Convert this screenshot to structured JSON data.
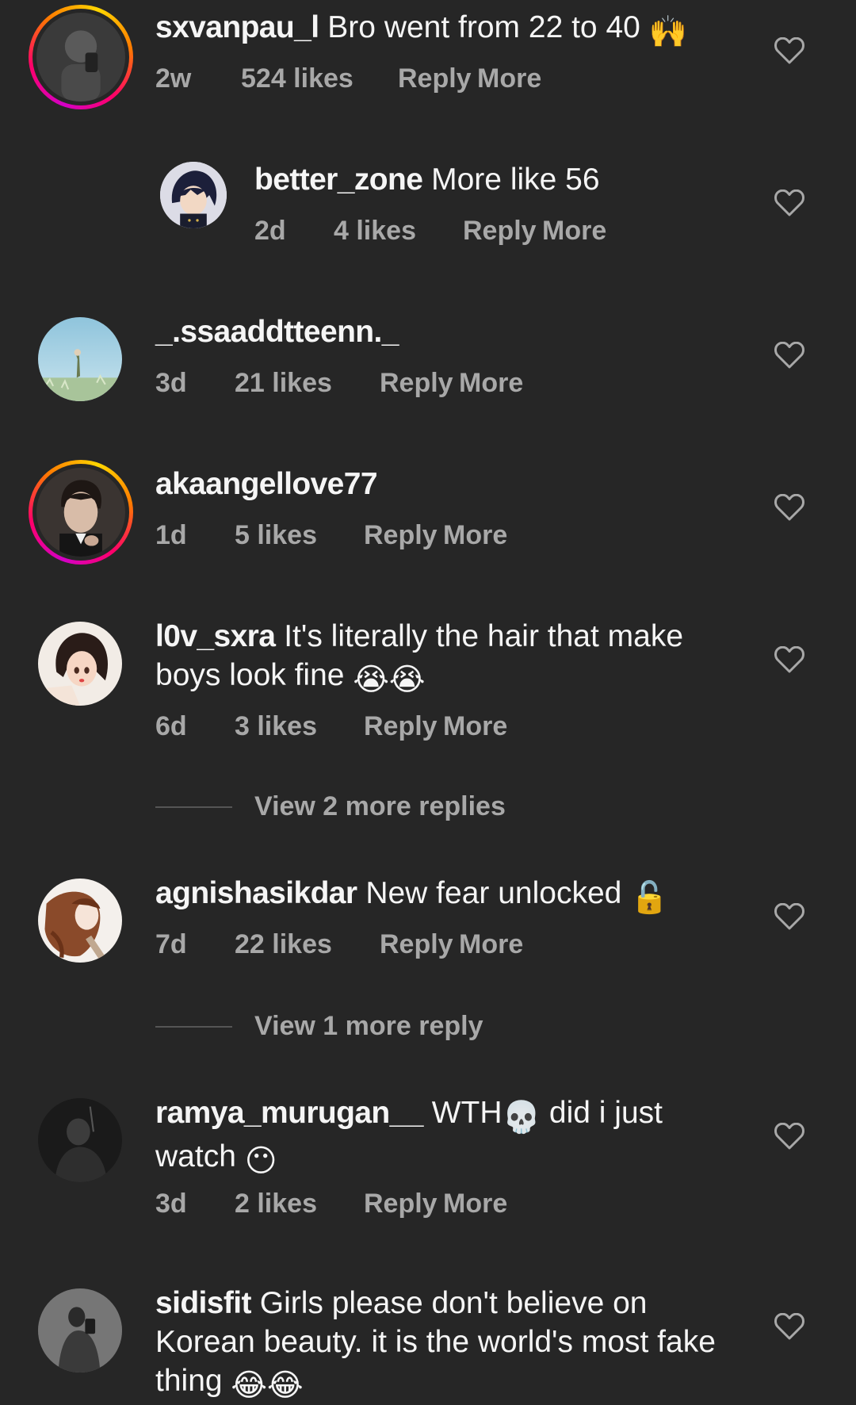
{
  "comments": [
    {
      "username": "sxvanpau_l",
      "text": "Bro went from 22 to 40",
      "emoji": "🙌",
      "time": "2w",
      "likes": "524 likes",
      "reply": "Reply",
      "more": "More"
    },
    {
      "username": "better_zone",
      "text": "More like 56",
      "time": "2d",
      "likes": "4 likes",
      "reply": "Reply",
      "more": "More"
    },
    {
      "username": "_.ssaaddtteenn._",
      "text": "",
      "time": "3d",
      "likes": "21 likes",
      "reply": "Reply",
      "more": "More"
    },
    {
      "username": "akaangellove77",
      "text": "",
      "time": "1d",
      "likes": "5 likes",
      "reply": "Reply",
      "more": "More"
    },
    {
      "username": "l0v_sxra",
      "text": "It's literally the hair that make boys look fine",
      "emoji": "😭😭",
      "time": "6d",
      "likes": "3 likes",
      "reply": "Reply",
      "more": "More",
      "view_replies": "View 2 more replies"
    },
    {
      "username": "agnishasikdar",
      "text": "New fear unlocked",
      "emoji": "🔓",
      "time": "7d",
      "likes": "22 likes",
      "reply": "Reply",
      "more": "More",
      "view_replies": "View 1 more reply"
    },
    {
      "username": "ramya_murugan__",
      "text_a": "WTH",
      "emoji_a": "💀",
      "text_b": "did i just watch",
      "emoji_b": "😶",
      "time": "3d",
      "likes": "2 likes",
      "reply": "Reply",
      "more": "More"
    },
    {
      "username": "sidisfit",
      "text": "Girls please don't believe on Korean beauty. it is the world's most fake thing",
      "emoji": "😂😂"
    }
  ],
  "colors": {
    "background": "#262626",
    "text": "#f5f5f5",
    "muted": "#a8a8a8",
    "story_ring": [
      "#d300c5",
      "#ff0069",
      "#ff7a00",
      "#ffd600"
    ]
  },
  "icons": {
    "like": "heart-outline-icon"
  }
}
